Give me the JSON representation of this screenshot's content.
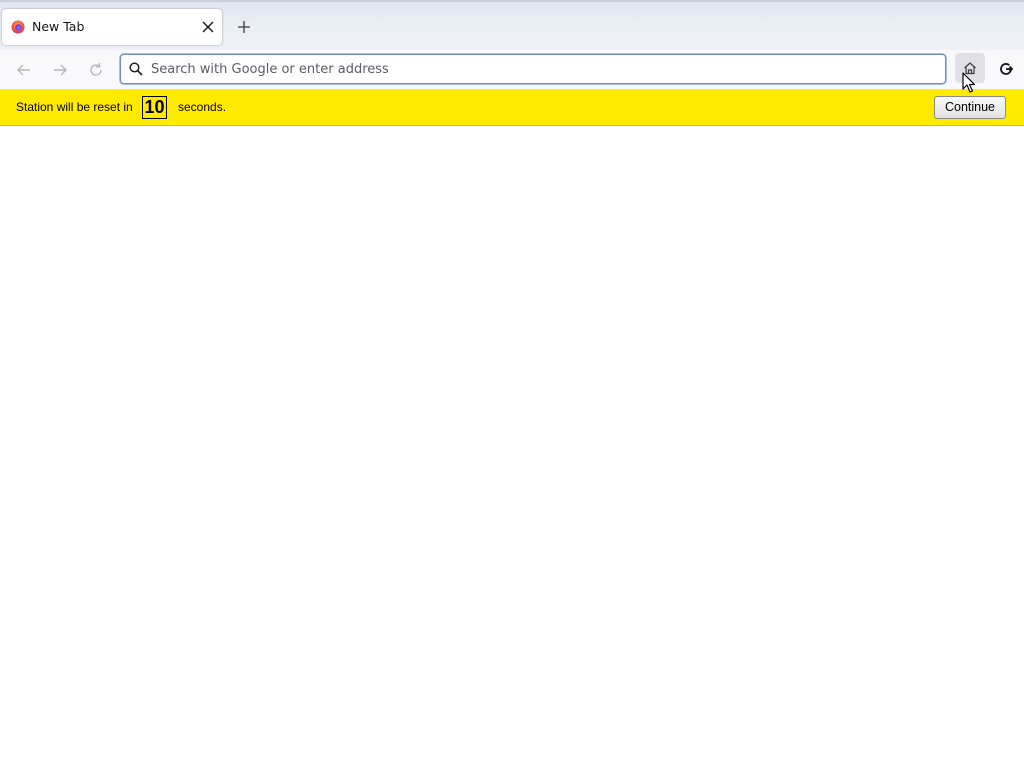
{
  "tabs": [
    {
      "title": "New Tab",
      "active": true
    }
  ],
  "toolbar": {
    "back_icon": "arrow-left-icon",
    "forward_icon": "arrow-right-icon",
    "reload_icon": "reload-icon",
    "home_icon": "home-icon",
    "extension_icon": "reset-icon"
  },
  "urlbar": {
    "value": "",
    "placeholder": "Search with Google or enter address"
  },
  "notification": {
    "text_before": "Station will be reset in",
    "countdown": "10",
    "text_after": "seconds.",
    "button_label": "Continue",
    "background_color": "#ffea00"
  }
}
